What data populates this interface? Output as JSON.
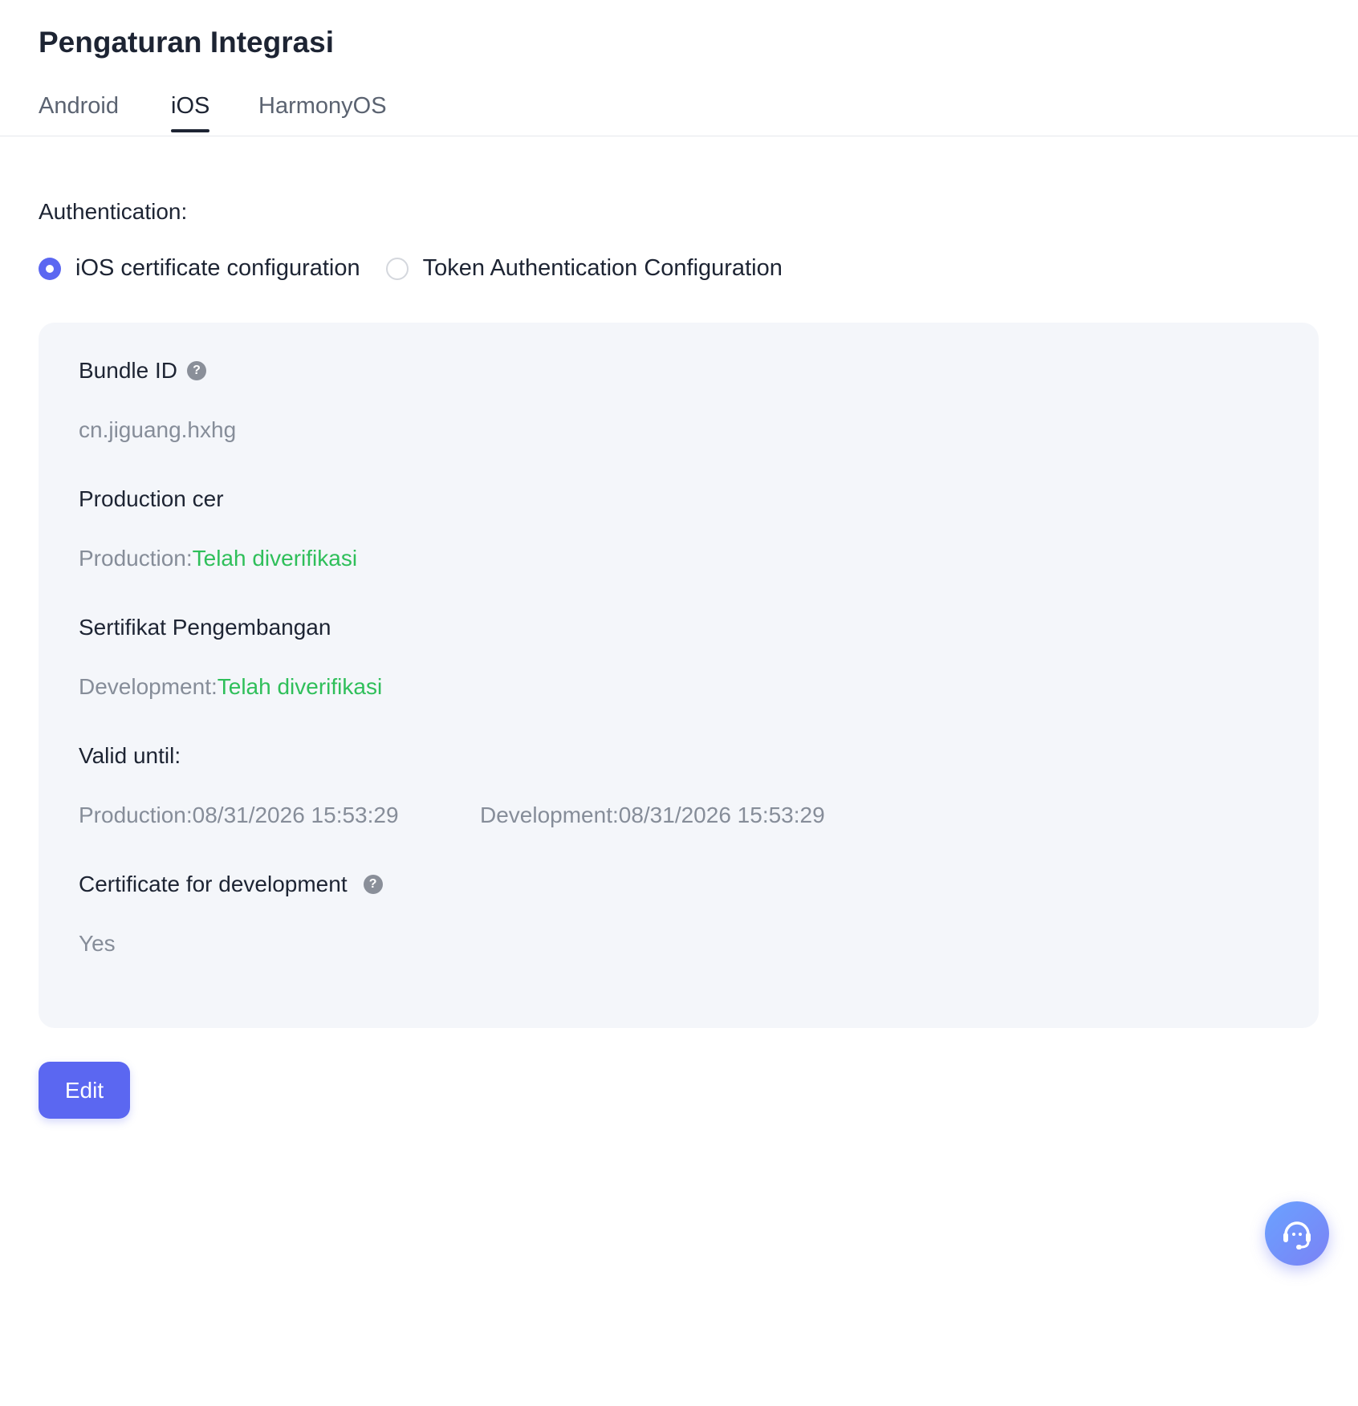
{
  "page": {
    "title": "Pengaturan Integrasi"
  },
  "tabs": [
    {
      "label": "Android",
      "active": false
    },
    {
      "label": "iOS",
      "active": true
    },
    {
      "label": "HarmonyOS",
      "active": false
    }
  ],
  "authentication": {
    "label": "Authentication:",
    "options": [
      {
        "label": "iOS certificate configuration",
        "selected": true
      },
      {
        "label": "Token Authentication Configuration",
        "selected": false
      }
    ]
  },
  "panel": {
    "bundle_id": {
      "label": "Bundle ID",
      "value": "cn.jiguang.hxhg"
    },
    "production_cert": {
      "label": "Production cer",
      "prefix": "Production:",
      "status": "Telah diverifikasi"
    },
    "development_cert": {
      "label": "Sertifikat Pengembangan",
      "prefix": "Development:",
      "status": "Telah diverifikasi"
    },
    "valid_until": {
      "label": "Valid until:",
      "production": "Production:08/31/2026 15:53:29",
      "development": "Development:08/31/2026 15:53:29"
    },
    "certificate_for_development": {
      "label": "Certificate for development",
      "value": "Yes"
    }
  },
  "actions": {
    "edit_label": "Edit"
  },
  "icons": {
    "help": "help-icon",
    "support": "headset-icon"
  },
  "colors": {
    "accent": "#5b67f1",
    "verified": "#2fbf5a",
    "panel_bg": "#f4f6fa"
  }
}
